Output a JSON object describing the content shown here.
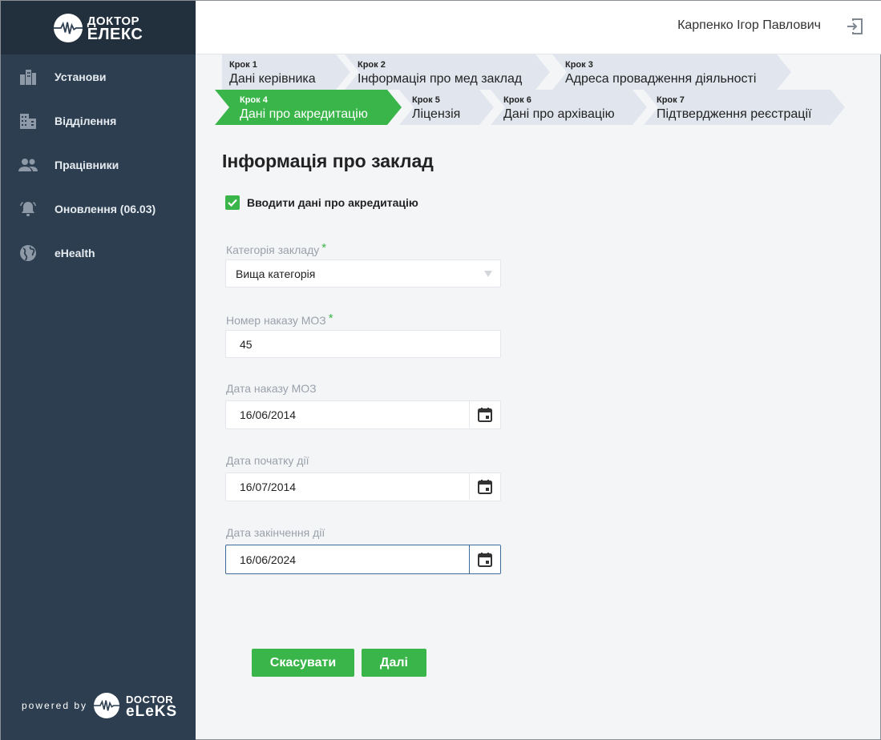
{
  "brand": {
    "logo_line1": "ДОКТОР",
    "logo_line2": "ЕЛЕКС",
    "powered_by": "powered by",
    "footer_line1": "DOCTOR",
    "footer_line2": "eLeKS"
  },
  "sidebar": {
    "items": [
      {
        "label": "Установи",
        "icon": "building-icon"
      },
      {
        "label": "Відділення",
        "icon": "office-icon"
      },
      {
        "label": "Працівники",
        "icon": "people-icon"
      },
      {
        "label": "Оновлення (06.03)",
        "icon": "bell-icon"
      },
      {
        "label": "eHealth",
        "icon": "globe-icon"
      }
    ]
  },
  "header": {
    "user_name": "Карпенко Ігор Павлович",
    "logout_icon": "logout-icon"
  },
  "steps": [
    {
      "num": "Крок 1",
      "title": "Дані керівника"
    },
    {
      "num": "Крок 2",
      "title": "Інформація про мед заклад"
    },
    {
      "num": "Крок 3",
      "title": "Адреса провадження діяльності"
    },
    {
      "num": "Крок 4",
      "title": "Дані про акредитацію",
      "active": true
    },
    {
      "num": "Крок 5",
      "title": "Ліцензія"
    },
    {
      "num": "Крок 6",
      "title": "Дані про архівацію"
    },
    {
      "num": "Крок 7",
      "title": "Підтвердження реєстрації"
    }
  ],
  "form": {
    "title": "Інформація про заклад",
    "checkbox_label": "Вводити дані про акредитацію",
    "checkbox_checked": true,
    "category": {
      "label": "Категорія закладу",
      "required": "*",
      "value": "Вища категорія"
    },
    "order_number": {
      "label": "Номер наказу МОЗ",
      "required": "*",
      "value": "45"
    },
    "order_date": {
      "label": "Дата наказу МОЗ",
      "value": "16/06/2014"
    },
    "start_date": {
      "label": "Дата початку дії",
      "value": "16/07/2014"
    },
    "end_date": {
      "label": "Дата закінчення дії",
      "value": "16/06/2024"
    }
  },
  "actions": {
    "cancel": "Скасувати",
    "next": "Далі"
  },
  "colors": {
    "sidebar": "#2c3e50",
    "accent": "#3ab54a",
    "step_inactive": "#e1e6ee"
  }
}
